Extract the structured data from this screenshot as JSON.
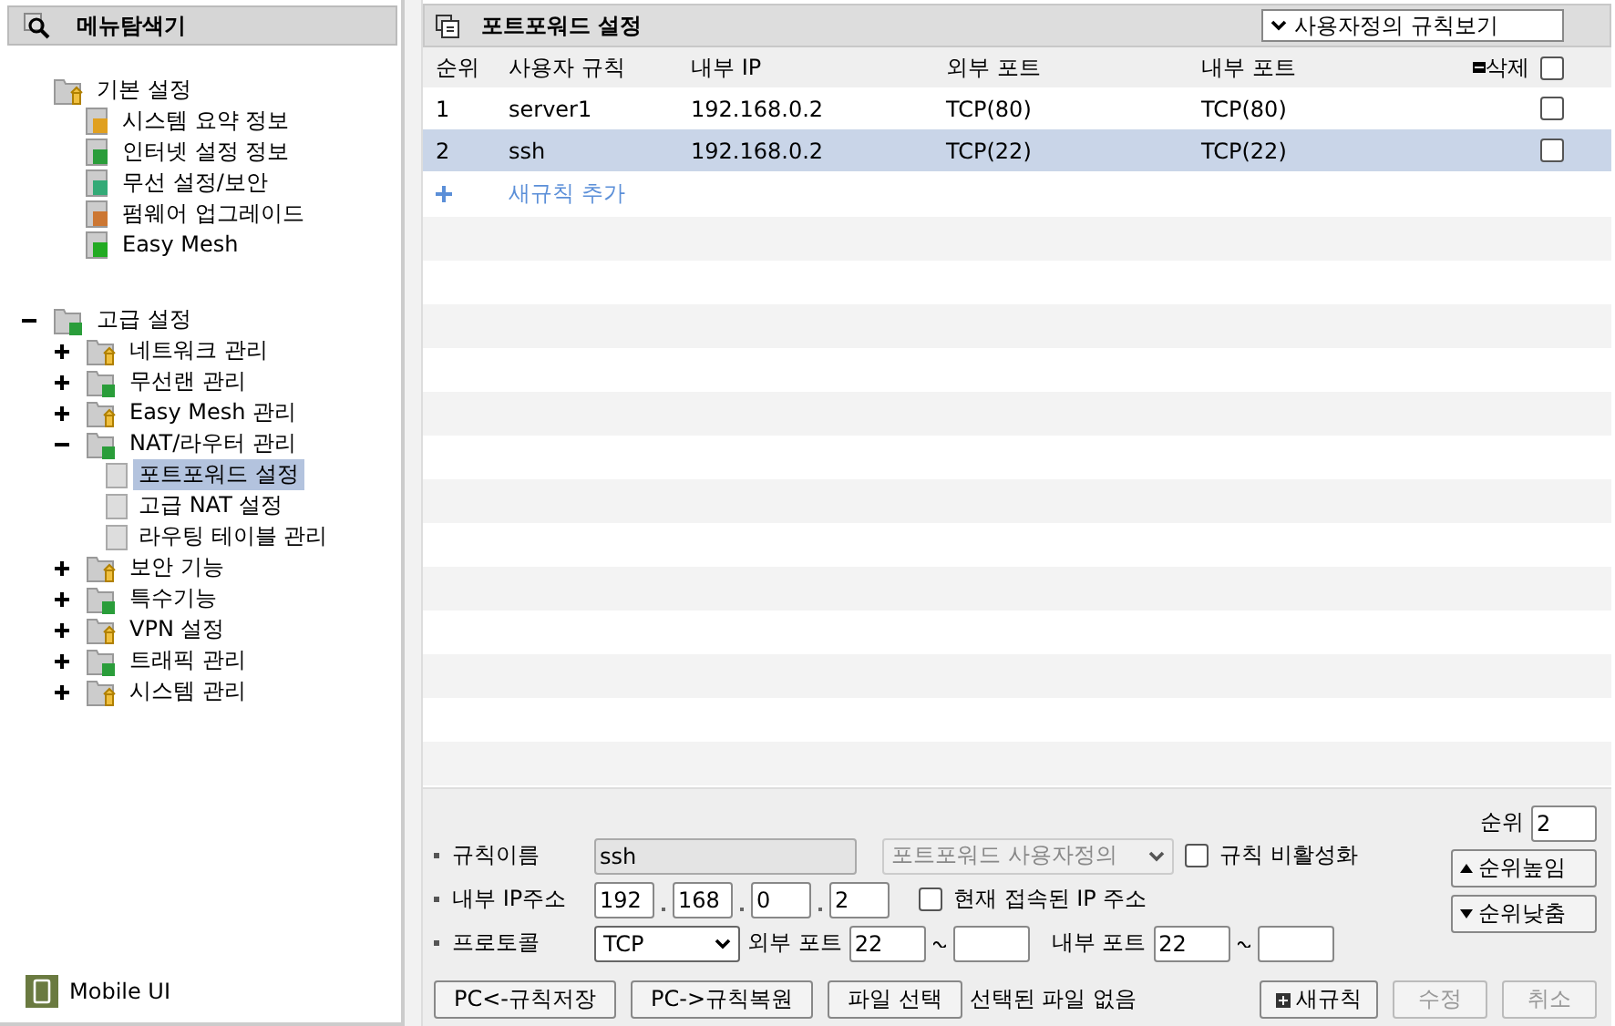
{
  "sidebar": {
    "title": "메뉴탐색기",
    "tree": [
      {
        "label": "기본 설정",
        "children": [
          {
            "label": "시스템 요약 정보"
          },
          {
            "label": "인터넷 설정 정보"
          },
          {
            "label": "무선 설정/보안"
          },
          {
            "label": "펌웨어 업그레이드"
          },
          {
            "label": "Easy Mesh"
          }
        ]
      },
      {
        "label": "고급 설정",
        "expanded": true,
        "children": [
          {
            "label": "네트워크 관리",
            "expanded": false
          },
          {
            "label": "무선랜 관리",
            "expanded": false
          },
          {
            "label": "Easy Mesh 관리",
            "expanded": false
          },
          {
            "label": "NAT/라우터 관리",
            "expanded": true,
            "children": [
              {
                "label": "포트포워드 설정",
                "selected": true
              },
              {
                "label": "고급 NAT 설정",
                "selected": false
              },
              {
                "label": "라우팅 테이블 관리",
                "selected": false
              }
            ]
          },
          {
            "label": "보안 기능",
            "expanded": false
          },
          {
            "label": "특수기능",
            "expanded": false
          },
          {
            "label": "VPN 설정",
            "expanded": false
          },
          {
            "label": "트래픽 관리",
            "expanded": false
          },
          {
            "label": "시스템 관리",
            "expanded": false
          }
        ]
      }
    ],
    "footer": "Mobile UI"
  },
  "main": {
    "title": "포트포워드 설정",
    "view_select": "사용자정의 규칙보기",
    "columns": [
      "순위",
      "사용자 규칙",
      "내부 IP",
      "외부 포트",
      "내부 포트"
    ],
    "delete_header": {
      "label": "삭제",
      "checked": false
    },
    "rows": [
      {
        "cells": [
          "1",
          "server1",
          "192.168.0.2",
          "TCP(80)",
          "TCP(80)"
        ],
        "selected": false,
        "checked": false
      },
      {
        "cells": [
          "2",
          "ssh",
          "192.168.0.2",
          "TCP(22)",
          "TCP(22)"
        ],
        "selected": true,
        "checked": false
      }
    ],
    "add_rule": "새규칙 추가"
  },
  "form": {
    "rule_name": {
      "label": "규칙이름",
      "value": "ssh",
      "disabled": true
    },
    "preset": {
      "value": "포트포워드 사용자정의",
      "disabled": true
    },
    "disable_rule": {
      "label": "규칙 비활성화",
      "checked": false
    },
    "ip": {
      "label": "내부 IP주소",
      "octets": [
        "192",
        "168",
        "0",
        "2"
      ]
    },
    "current_ip": {
      "label": "현재 접속된 IP 주소",
      "checked": false
    },
    "protocol": {
      "label": "프로토콜",
      "value": "TCP"
    },
    "external_port": {
      "label": "외부 포트",
      "from": "22"
    },
    "internal_port": {
      "label": "내부 포트",
      "from": "22"
    },
    "order": {
      "label": "순위",
      "value": "2"
    },
    "order_buttons": [
      "순위높임",
      "순위낮춤"
    ],
    "buttons": [
      {
        "label": "PC<-규칙저장",
        "disabled": false
      },
      {
        "label": "PC->규칙복원",
        "disabled": false
      },
      {
        "label": "파일 선택",
        "disabled": false
      }
    ],
    "file_status": "선택된 파일 없음",
    "actions": [
      {
        "label": "새규칙",
        "kind": "new",
        "disabled": false
      },
      {
        "label": "수정",
        "kind": "plain",
        "disabled": true
      },
      {
        "label": "취소",
        "kind": "plain",
        "disabled": true
      }
    ]
  }
}
